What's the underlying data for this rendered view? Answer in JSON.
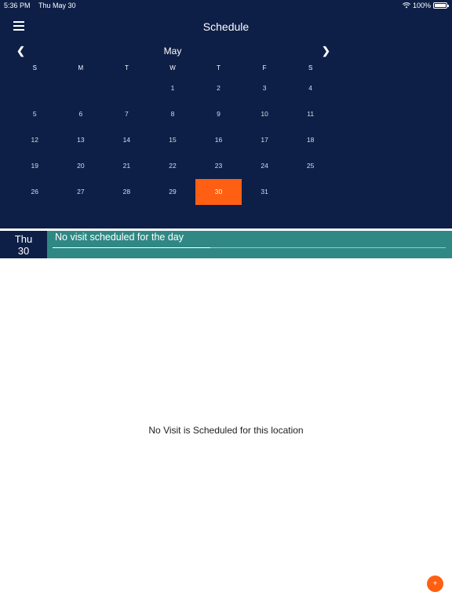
{
  "status_bar": {
    "time": "5:36 PM",
    "date": "Thu May 30",
    "battery": "100%"
  },
  "header": {
    "title": "Schedule"
  },
  "calendar": {
    "month": "May",
    "prev_icon": "❮",
    "next_icon": "❯",
    "weekdays": [
      "S",
      "M",
      "T",
      "W",
      "T",
      "F",
      "S"
    ],
    "weeks": [
      [
        "",
        "",
        "",
        "1",
        "2",
        "3",
        "4"
      ],
      [
        "5",
        "6",
        "7",
        "8",
        "9",
        "10",
        "11"
      ],
      [
        "12",
        "13",
        "14",
        "15",
        "16",
        "17",
        "18"
      ],
      [
        "19",
        "20",
        "21",
        "22",
        "23",
        "24",
        "25"
      ],
      [
        "26",
        "27",
        "28",
        "29",
        "30",
        "31",
        ""
      ]
    ],
    "selected_day": "30",
    "selected_color": "#ff5f12"
  },
  "day_band": {
    "weekday": "Thu",
    "day": "30",
    "message": "No visit scheduled for the day"
  },
  "empty_state": {
    "message": "No Visit is Scheduled for this location"
  },
  "fab": {
    "label": "+",
    "color": "#ff5f12"
  },
  "colors": {
    "header_bg": "#0d1f47",
    "band_bg": "#2f8884"
  }
}
